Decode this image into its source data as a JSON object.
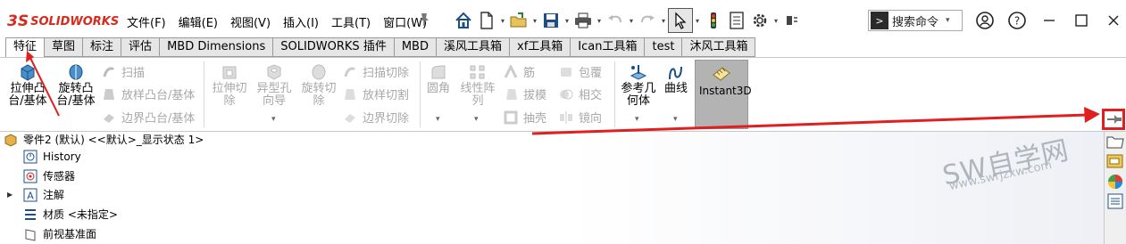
{
  "app": {
    "brand_mark": "3S",
    "brand_name": "SOLIDWORKS"
  },
  "menu": [
    "文件(F)",
    "编辑(E)",
    "视图(V)",
    "插入(I)",
    "工具(T)",
    "窗口(W)"
  ],
  "search": {
    "placeholder": "搜索命令",
    "cmd_glyph": ">"
  },
  "tabs": [
    "特征",
    "草图",
    "标注",
    "评估",
    "MBD Dimensions",
    "SOLIDWORKS 插件",
    "MBD",
    "溪风工具箱",
    "xf工具箱",
    "Ican工具箱",
    "test",
    "沐风工具箱"
  ],
  "active_tab": "特征",
  "ribbon": {
    "extrude_boss": [
      "拉伸凸",
      "台/基体"
    ],
    "revolve_boss": [
      "旋转凸",
      "台/基体"
    ],
    "sweep": "扫描",
    "loft_boss": "放样凸台/基体",
    "boundary_boss": "边界凸台/基体",
    "extrude_cut": [
      "拉伸切",
      "除"
    ],
    "hole_wizard": [
      "异型孔",
      "向导"
    ],
    "revolve_cut": [
      "旋转切",
      "除"
    ],
    "sweep_cut": "扫描切除",
    "loft_cut": "放样切割",
    "boundary_cut": "边界切除",
    "fillet": "圆角",
    "linear_pattern": [
      "线性阵",
      "列"
    ],
    "rib": "筋",
    "draft": "拔模",
    "shell": "抽壳",
    "wrap": "包覆",
    "intersect": "相交",
    "mirror": "镜向",
    "ref_geometry": [
      "参考几",
      "何体"
    ],
    "curves": "曲线",
    "instant3d": "Instant3D"
  },
  "tree": {
    "part": "零件2 (默认) <<默认>_显示状态 1>",
    "items": [
      "History",
      "传感器",
      "注解",
      "材质 <未指定>",
      "前视基准面"
    ]
  },
  "watermark": {
    "line1": "SW自学网",
    "line2": "www.swrjzxw.com"
  },
  "colors": {
    "brand": "#d52b1e",
    "annotation": "#e02020",
    "instant3d_bg": "#b3b3b3"
  }
}
